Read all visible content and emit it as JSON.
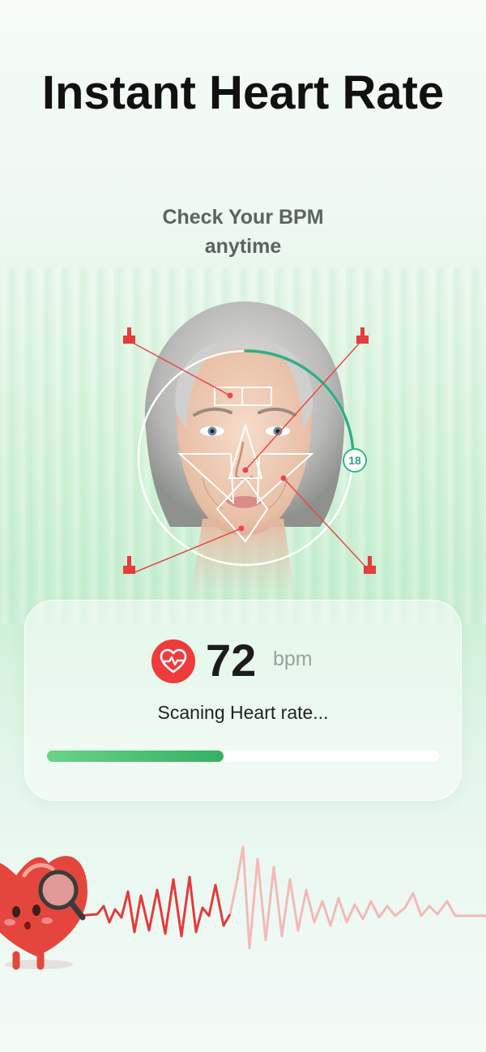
{
  "hero": {
    "title": "Instant Heart Rate",
    "subtitle_line1": "Check Your BPM",
    "subtitle_line2": "anytime"
  },
  "scan": {
    "timer_value": "18"
  },
  "reading": {
    "value": "72",
    "unit": "bpm",
    "status": "Scaning Heart rate...",
    "progress": 0.45
  },
  "colors": {
    "accent_green": "#36b062",
    "alert_red": "#ef3b3b",
    "timer_teal": "#2aa57d"
  },
  "icons": {
    "heart": "heart-pulse-icon",
    "corner": "corner-marker-icon",
    "mascot": "heart-mascot-magnifier"
  }
}
